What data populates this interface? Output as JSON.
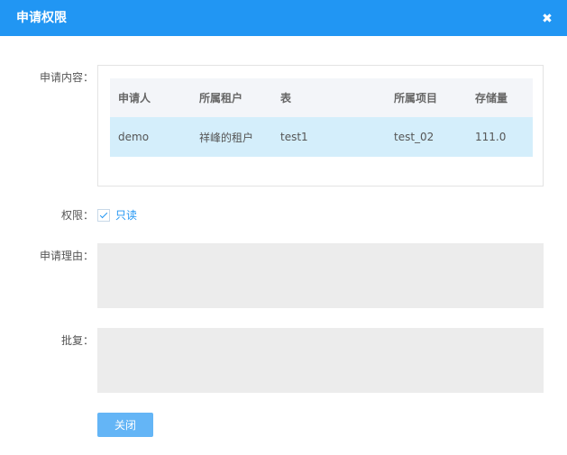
{
  "dialog": {
    "title": "申请权限",
    "close_icon": "close-icon"
  },
  "form": {
    "content_label": "申请内容：",
    "permission_label": "权限：",
    "permission_value": "只读",
    "permission_checked": true,
    "reason_label": "申请理由：",
    "reason_value": "",
    "approval_label": "批复：",
    "approval_value": ""
  },
  "table": {
    "headers": [
      "申请人",
      "所属租户",
      "表",
      "所属项目",
      "存储量"
    ],
    "rows": [
      [
        "demo",
        "祥峰的租户",
        "test1",
        "test_02",
        "111.0"
      ]
    ]
  },
  "footer": {
    "close_label": "关闭"
  },
  "colors": {
    "header_bg": "#2196f3",
    "row_highlight": "#d4eefb",
    "button_bg": "#64b5f6"
  }
}
